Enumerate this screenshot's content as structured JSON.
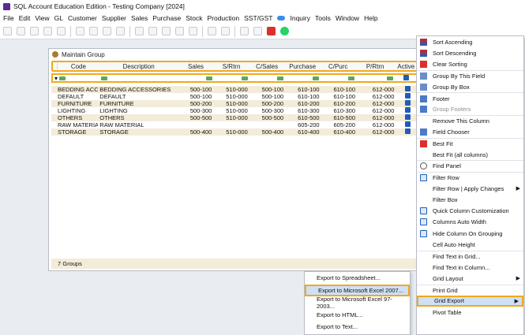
{
  "window_title": "SQL Account Education Edition - Testing Company [2024]",
  "menu": [
    "File",
    "Edit",
    "View",
    "GL",
    "Customer",
    "Supplier",
    "Sales",
    "Purchase",
    "Stock",
    "Production",
    "SST/GST",
    "Inquiry",
    "Tools",
    "Window",
    "Help"
  ],
  "child_window": {
    "title": "Maintain Group",
    "columns": [
      "Code",
      "Description",
      "Sales",
      "S/Rtrn",
      "C/Sales",
      "Purchase",
      "C/Purc",
      "P/Rtrn",
      "Active"
    ],
    "rows": [
      {
        "code": "BEDDING ACC...",
        "desc": "BEDDING ACCESSORIES",
        "sales": "500-100",
        "srtn": "510-000",
        "csales": "500-100",
        "purch": "610-100",
        "cpurc": "610-100",
        "prtn": "612-000"
      },
      {
        "code": "DEFAULT",
        "desc": "DEFAULT",
        "sales": "500-100",
        "srtn": "510-000",
        "csales": "500-100",
        "purch": "610-100",
        "cpurc": "610-100",
        "prtn": "612-000"
      },
      {
        "code": "FURNITURE",
        "desc": "FURNITURE",
        "sales": "500-200",
        "srtn": "510-000",
        "csales": "500-200",
        "purch": "610-200",
        "cpurc": "610-200",
        "prtn": "612-000"
      },
      {
        "code": "LIGHTING",
        "desc": "LIGHTING",
        "sales": "500-300",
        "srtn": "510-000",
        "csales": "500-300",
        "purch": "610-300",
        "cpurc": "610-300",
        "prtn": "612-000"
      },
      {
        "code": "OTHERS",
        "desc": "OTHERS",
        "sales": "500-500",
        "srtn": "510-000",
        "csales": "500-500",
        "purch": "610-500",
        "cpurc": "610-500",
        "prtn": "612-000"
      },
      {
        "code": "RAW MATERIAL",
        "desc": "RAW MATERIAL",
        "sales": "",
        "srtn": "",
        "csales": "",
        "purch": "605-200",
        "cpurc": "605-200",
        "prtn": "612-000"
      },
      {
        "code": "STORAGE",
        "desc": "STORAGE",
        "sales": "500-400",
        "srtn": "510-000",
        "csales": "500-400",
        "purch": "610-400",
        "cpurc": "610-400",
        "prtn": "612-000"
      }
    ],
    "footer": "7 Groups"
  },
  "context_menu": [
    {
      "label": "Sort Ascending",
      "icon": "sort-asc-icon"
    },
    {
      "label": "Sort Descending",
      "icon": "sort-desc-icon"
    },
    {
      "label": "Clear Sorting",
      "icon": "clear-sort-icon"
    },
    {
      "label": "Group By This Field",
      "icon": "group-field-icon",
      "sep": true
    },
    {
      "label": "Group By Box",
      "icon": "group-box-icon"
    },
    {
      "label": "Footer",
      "icon": "footer-icon",
      "sep": true
    },
    {
      "label": "Group Footers",
      "icon": "group-footers-icon",
      "disabled": true
    },
    {
      "label": "Remove This Column",
      "icon": "",
      "sep": true
    },
    {
      "label": "Field Chooser",
      "icon": "field-chooser-icon"
    },
    {
      "label": "Best Fit",
      "icon": "best-fit-icon",
      "sep": true
    },
    {
      "label": "Best Fit (all columns)",
      "icon": ""
    },
    {
      "label": "Find Panel",
      "icon": "find-panel-icon",
      "sep": true
    },
    {
      "label": "Filter Row",
      "icon": "check-icon",
      "checked": true,
      "sep": true
    },
    {
      "label": "Filter Row | Apply Changes",
      "icon": "",
      "submenu": true
    },
    {
      "label": "Filter Box",
      "icon": ""
    },
    {
      "label": "Quick Column Customization",
      "icon": "check-icon",
      "checked": true
    },
    {
      "label": "Columns Auto Width",
      "icon": "check-icon",
      "checked": true
    },
    {
      "label": "Hide Column On Grouping",
      "icon": "check-icon",
      "checked": true
    },
    {
      "label": "Cell Auto Height",
      "icon": ""
    },
    {
      "label": "Find Text in Grid...",
      "icon": "",
      "sep": true
    },
    {
      "label": "Find Text in Column...",
      "icon": ""
    },
    {
      "label": "Grid Layout",
      "icon": "",
      "submenu": true
    },
    {
      "label": "Print Grid",
      "icon": "",
      "sep": true
    },
    {
      "label": "Grid Export",
      "icon": "",
      "submenu": true,
      "highlight": true
    },
    {
      "label": "Pivot Table",
      "icon": ""
    }
  ],
  "export_submenu": [
    {
      "label": "Export to Spreadsheet..."
    },
    {
      "label": "Export to Microsoft Excel 2007...",
      "highlight": true
    },
    {
      "label": "Export to Microsoft Excel 97-2003..."
    },
    {
      "label": "Export to HTML..."
    },
    {
      "label": "Export to Text..."
    }
  ]
}
